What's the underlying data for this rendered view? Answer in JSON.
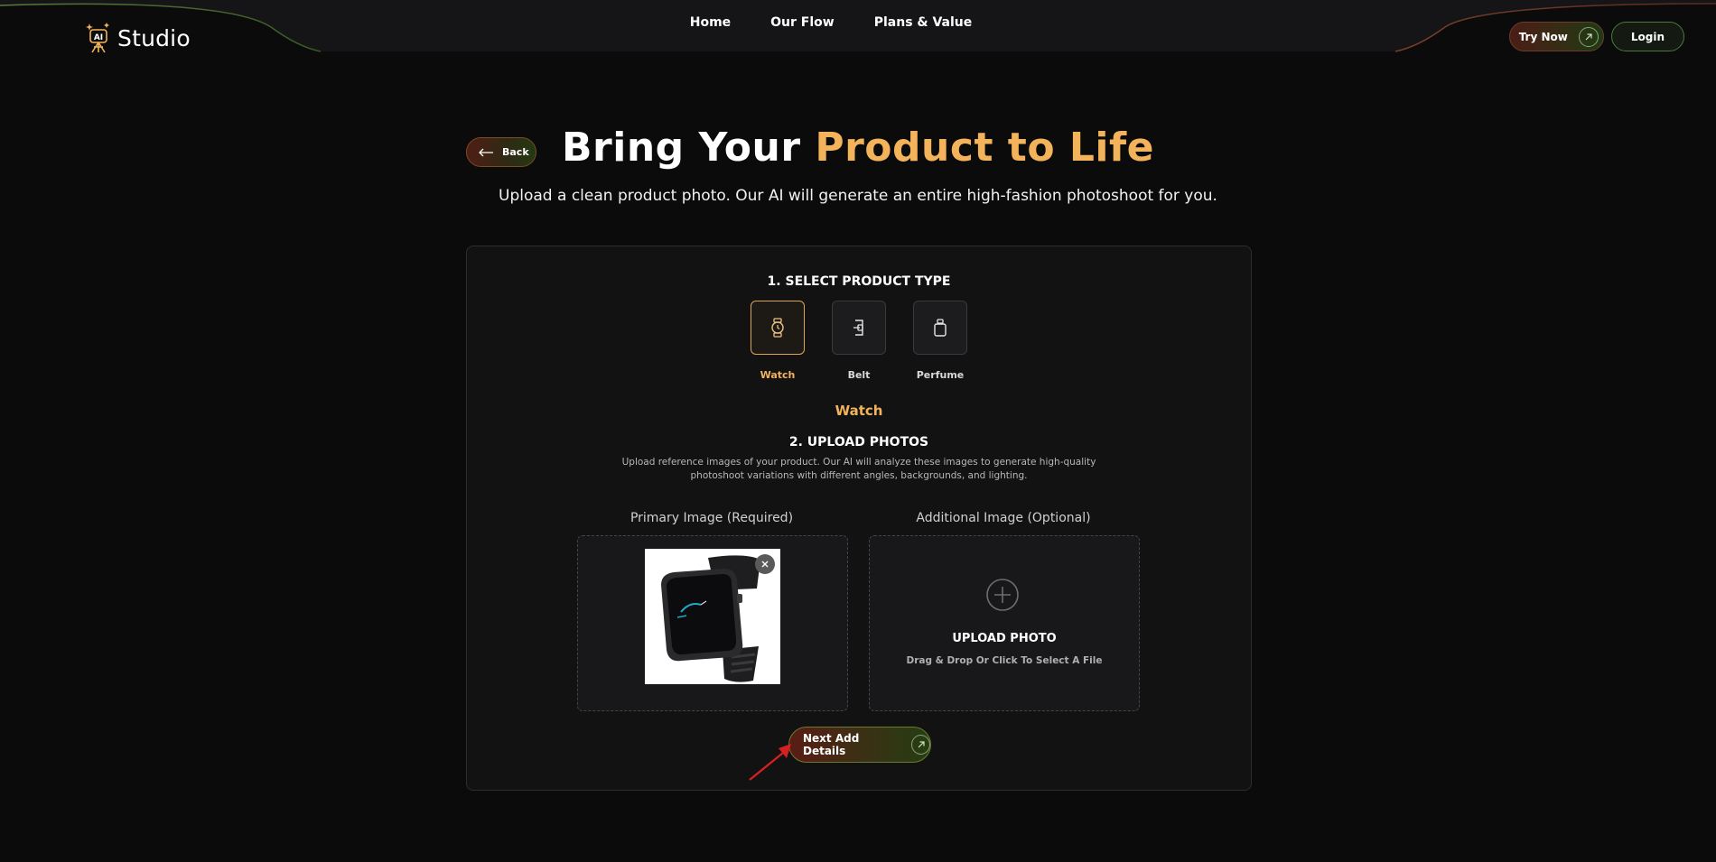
{
  "header": {
    "logo_badge": "AI",
    "logo_text": "Studio",
    "nav": [
      "Home",
      "Our Flow",
      "Plans & Value"
    ],
    "try_now_label": "Try Now",
    "login_label": "Login"
  },
  "hero": {
    "back_label": "Back",
    "title_part1": "Bring Your ",
    "title_accent": "Product to Life",
    "subtitle": "Upload a clean product photo. Our AI will generate an entire high-fashion photoshoot for you."
  },
  "step1": {
    "title": "1. SELECT PRODUCT TYPE",
    "types": [
      {
        "label": "Watch",
        "icon": "watch-icon",
        "selected": true
      },
      {
        "label": "Belt",
        "icon": "belt-icon",
        "selected": false
      },
      {
        "label": "Perfume",
        "icon": "perfume-icon",
        "selected": false
      }
    ],
    "selected_label": "Watch"
  },
  "step2": {
    "title": "2. UPLOAD PHOTOS",
    "description": "Upload reference images of your product. Our AI will analyze these images to generate high-quality photoshoot variations with different angles, backgrounds, and lighting.",
    "primary_label": "Primary Image (Required)",
    "additional_label": "Additional Image (Optional)",
    "upload_title": "UPLOAD PHOTO",
    "upload_hint": "Drag & Drop Or Click To Select A File"
  },
  "next_label": "Next Add Details",
  "colors": {
    "accent": "#f3b35a",
    "background": "#0b0b0c",
    "card": "#121213",
    "annotation_arrow": "#d42020"
  }
}
